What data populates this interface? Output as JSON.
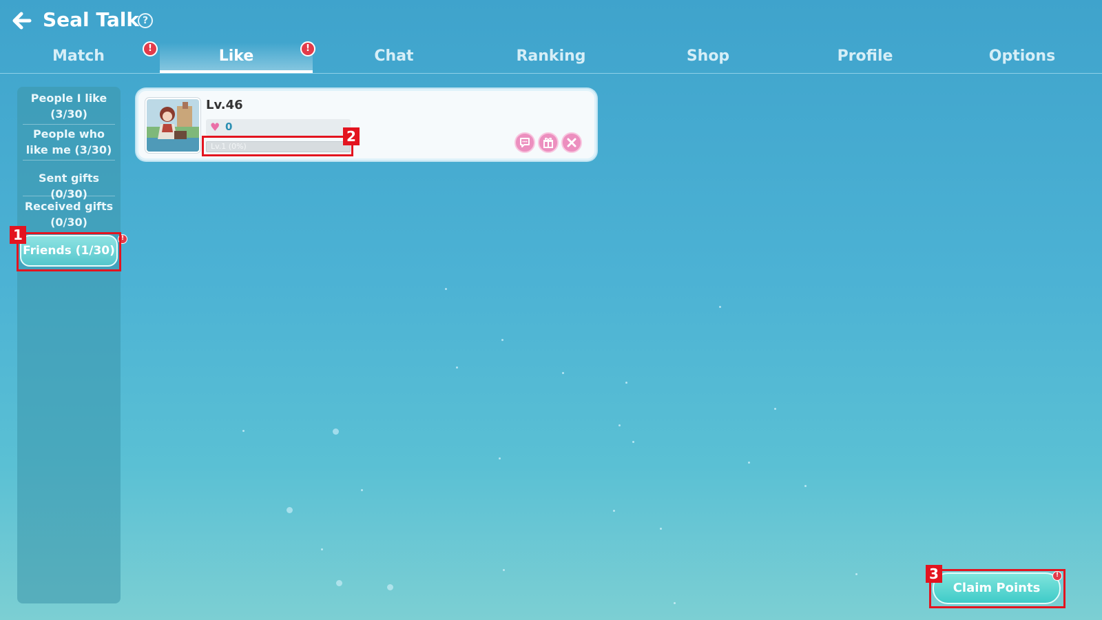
{
  "header": {
    "title": "Seal Talk",
    "help_label": "?"
  },
  "tabs": [
    {
      "label": "Match",
      "alert": "!"
    },
    {
      "label": "Like",
      "alert": "!"
    },
    {
      "label": "Chat"
    },
    {
      "label": "Ranking"
    },
    {
      "label": "Shop"
    },
    {
      "label": "Profile"
    },
    {
      "label": "Options"
    }
  ],
  "active_tab": "Like",
  "sidebar": {
    "items": [
      {
        "label": "People I like (3/30)"
      },
      {
        "label": "People who like me (3/30)"
      },
      {
        "label": "Sent gifts (0/30)"
      },
      {
        "label": "Received gifts (0/30)"
      },
      {
        "label": "Friends (1/30)",
        "alert": "!"
      }
    ]
  },
  "friend_card": {
    "level": "Lv.46",
    "likes": "0",
    "affinity_label": "Lv.1 (0%)",
    "affinity_progress": 0
  },
  "annotations": {
    "marker_1": "1",
    "marker_2": "2",
    "marker_3": "3"
  },
  "claim": {
    "label": "Claim Points",
    "alert": "!"
  },
  "colors": {
    "alert": "#e23b4a",
    "highlight": "#e3141f",
    "heart": "#ea6fa7",
    "action_pink": "#ec8fbf"
  }
}
